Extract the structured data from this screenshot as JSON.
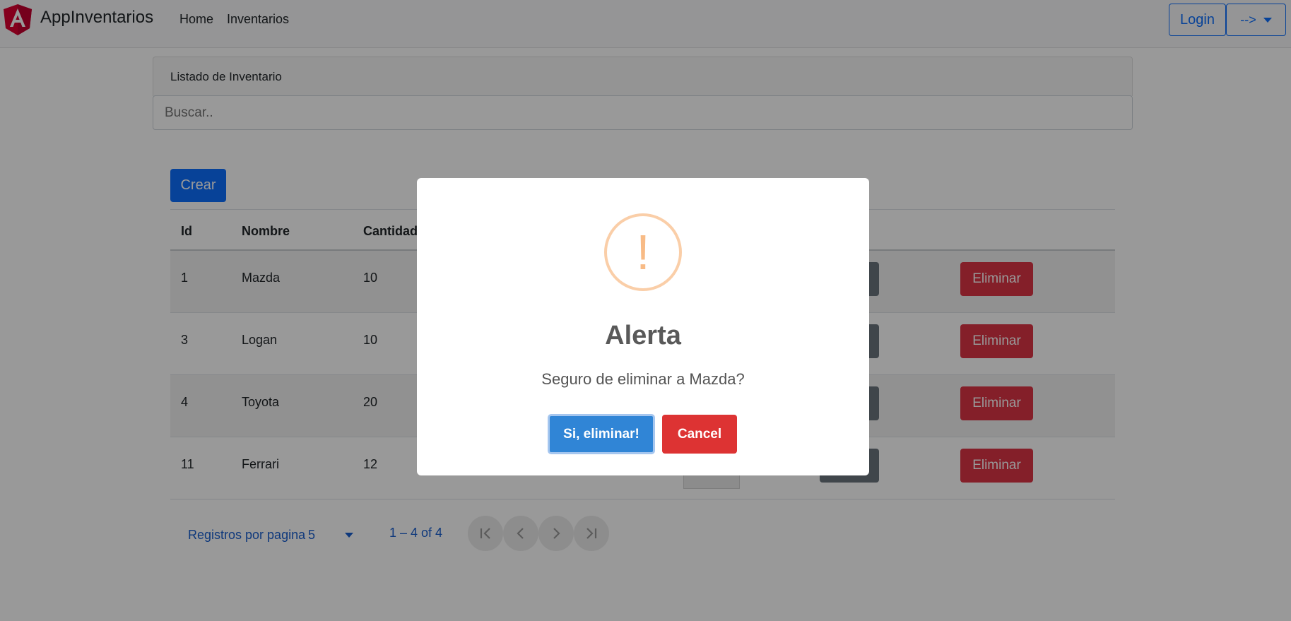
{
  "navbar": {
    "brand": "AppInventarios",
    "links": [
      {
        "label": "Home"
      },
      {
        "label": "Inventarios"
      }
    ],
    "login_label": "Login",
    "dropdown_label": "-->"
  },
  "card": {
    "header": "Listado de Inventario",
    "search_placeholder": "Buscar.."
  },
  "create_button": "Crear",
  "table": {
    "columns": [
      "Id",
      "Nombre",
      "Cantidad"
    ],
    "rows": [
      {
        "id": "1",
        "nombre": "Mazda",
        "cantidad": "10",
        "delete_label": "Eliminar"
      },
      {
        "id": "3",
        "nombre": "Logan",
        "cantidad": "10",
        "delete_label": "Eliminar"
      },
      {
        "id": "4",
        "nombre": "Toyota",
        "cantidad": "20",
        "delete_label": "Eliminar"
      },
      {
        "id": "11",
        "nombre": "Ferrari",
        "cantidad": "12",
        "delete_label": "Eliminar"
      }
    ]
  },
  "paginator": {
    "label": "Registros por pagina",
    "page_size": "5",
    "range": "1 – 4 of 4"
  },
  "dialog": {
    "title": "Alerta",
    "text": "Seguro de eliminar a Mazda?",
    "confirm_label": "Si, eliminar!",
    "cancel_label": "Cancel",
    "icon": "!"
  },
  "colors": {
    "primary": "#0d6efd",
    "danger": "#dc3545",
    "confirm": "#3085d6",
    "cancel": "#dd3333",
    "warning_icon": "#f8bb86"
  }
}
